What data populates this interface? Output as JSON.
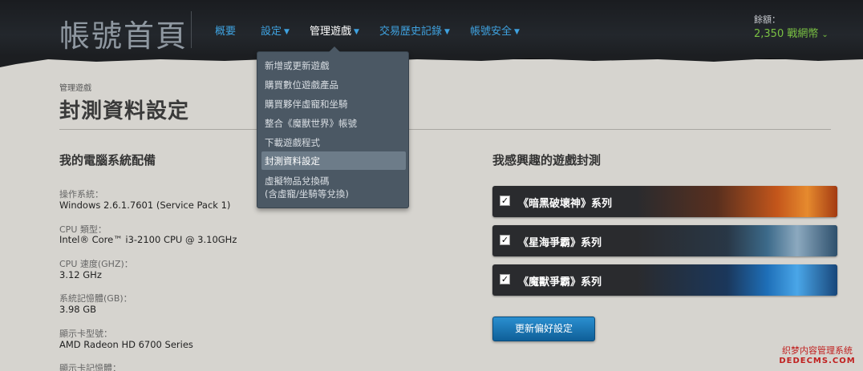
{
  "header": {
    "site_title": "帳號首頁",
    "nav": [
      {
        "label": "概要",
        "has_caret": false,
        "active": false
      },
      {
        "label": "設定",
        "has_caret": true,
        "active": false
      },
      {
        "label": "管理遊戲",
        "has_caret": true,
        "active": true
      },
      {
        "label": "交易歷史記錄",
        "has_caret": true,
        "active": false
      },
      {
        "label": "帳號安全",
        "has_caret": true,
        "active": false
      }
    ],
    "balance_label": "餘額：",
    "balance_value": "2,350 戰網幣"
  },
  "dropdown": {
    "items": [
      {
        "label": "新增或更新遊戲",
        "selected": false
      },
      {
        "label": "購買數位遊戲產品",
        "selected": false
      },
      {
        "label": "購買夥伴虛寵和坐騎",
        "selected": false
      },
      {
        "label": "整合《魔獸世界》帳號",
        "selected": false
      },
      {
        "label": "下載遊戲程式",
        "selected": false
      },
      {
        "label": "封測資料設定",
        "selected": true
      },
      {
        "label_line1": "虛擬物品兌換碼",
        "label_line2": "(含虛寵/坐騎等兌換)",
        "selected": false
      }
    ]
  },
  "page": {
    "breadcrumb": "管理遊戲",
    "title": "封測資料設定"
  },
  "system_specs": {
    "heading": "我的電腦系統配備",
    "items": [
      {
        "label": "操作系統：",
        "value": "Windows 2.6.1.7601 (Service Pack 1)"
      },
      {
        "label": "CPU 類型：",
        "value": "Intel® Core™ i3-2100 CPU @ 3.10GHz"
      },
      {
        "label": "CPU 速度(GHZ)：",
        "value": "3.12 GHz"
      },
      {
        "label": "系統記憶體(GB)：",
        "value": "3.98 GB"
      },
      {
        "label": "顯示卡型號：",
        "value": "AMD Radeon HD 6700 Series"
      },
      {
        "label": "顯示卡記憶體："
      }
    ]
  },
  "beta_interest": {
    "heading": "我感興趣的遊戲封測",
    "games": [
      {
        "label": "《暗黑破壞神》系列",
        "checked": true,
        "art": "diablo"
      },
      {
        "label": "《星海爭霸》系列",
        "checked": true,
        "art": "starcraft"
      },
      {
        "label": "《魔獸爭霸》系列",
        "checked": true,
        "art": "warcraft"
      }
    ],
    "update_button": "更新偏好設定"
  },
  "watermark": {
    "line1": "织梦内容管理系统",
    "line2": "DEDECMS.COM"
  },
  "colors": {
    "nav_link": "#3fa2e0",
    "balance": "#7ac143",
    "button": "#1577b8"
  }
}
